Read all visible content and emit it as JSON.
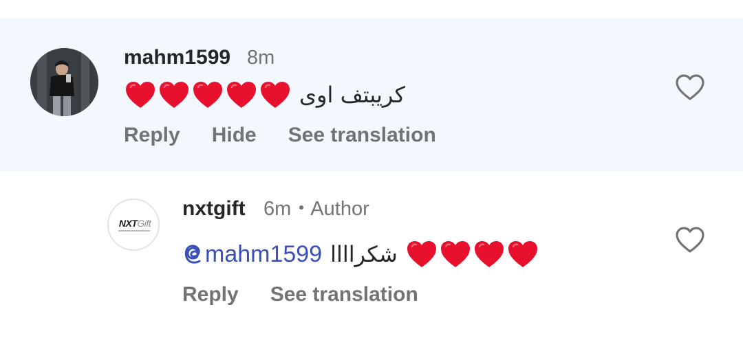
{
  "comments": [
    {
      "username": "mahm1599",
      "time": "8m",
      "text": "كريبتف اوى",
      "heart_count": 5,
      "actions": {
        "reply": "Reply",
        "hide": "Hide",
        "translate": "See translation"
      }
    },
    {
      "username": "nxtgift",
      "time": "6m",
      "author_label": "Author",
      "mention": "mahm1599",
      "text": "شكراااا",
      "heart_count": 4,
      "actions": {
        "reply": "Reply",
        "translate": "See translation"
      }
    }
  ],
  "brand_logo": {
    "text_main": "NXT",
    "text_accent": "Gift"
  },
  "colors": {
    "highlight_bg": "#f2f8fd",
    "mention": "#3b4fb8",
    "secondary_text": "#737373",
    "heart": "#e8112d"
  },
  "icons": [
    "heart-outline-icon",
    "heart-emoji",
    "threads-at-icon"
  ]
}
